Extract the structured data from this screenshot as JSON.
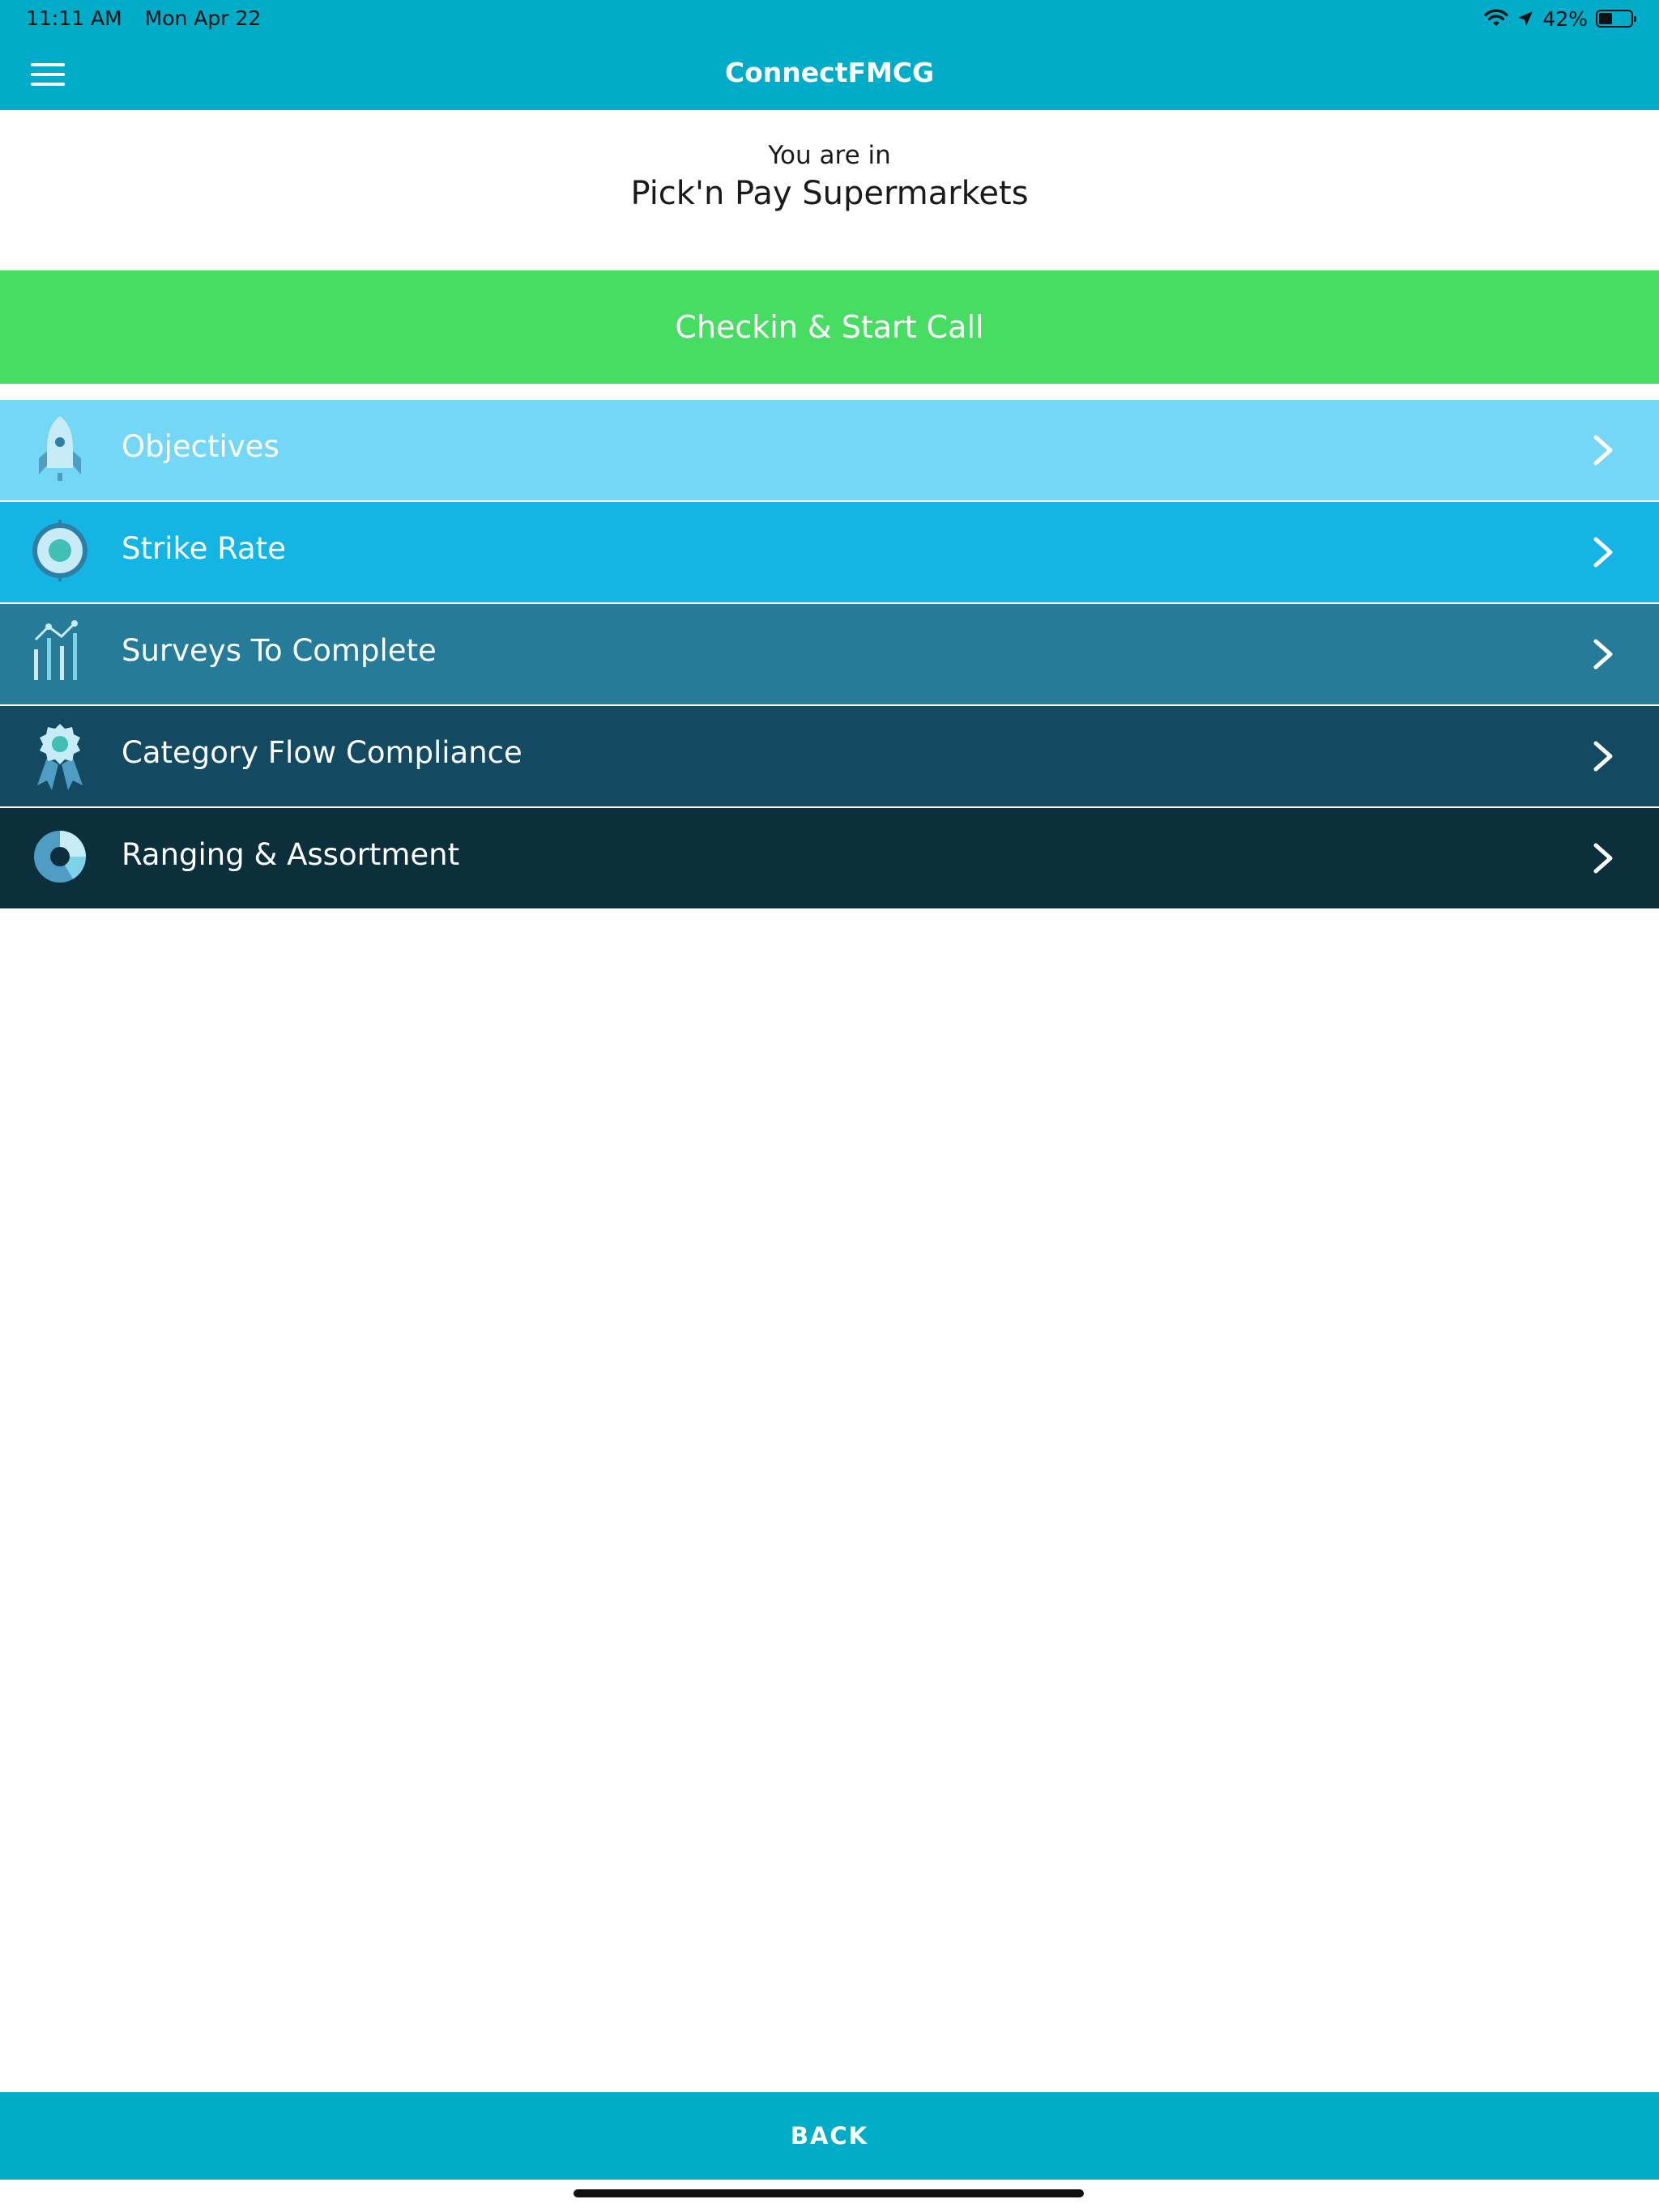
{
  "status_bar": {
    "time": "11:11 AM",
    "date": "Mon Apr 22",
    "battery_percent": "42%",
    "battery_level": 0.42,
    "icons": [
      "wifi-icon",
      "location-arrow-icon",
      "battery-icon"
    ]
  },
  "header": {
    "title": "ConnectFMCG",
    "menu_icon": "hamburger-menu-icon",
    "background_color": "#00acc8"
  },
  "location": {
    "label": "You are in",
    "name": "Pick'n Pay Supermarkets"
  },
  "checkin": {
    "label": "Checkin & Start Call",
    "color": "#47dd63"
  },
  "menu_items": [
    {
      "label": "Objectives",
      "icon": "rocket-icon",
      "color": "#74d7f6"
    },
    {
      "label": "Strike Rate",
      "icon": "target-icon",
      "color": "#14b4e4"
    },
    {
      "label": "Surveys To Complete",
      "icon": "bar-chart-icon",
      "color": "#267b98"
    },
    {
      "label": "Category Flow Compliance",
      "icon": "award-ribbon-icon",
      "color": "#134a61"
    },
    {
      "label": "Ranging & Assortment",
      "icon": "pie-chart-icon",
      "color": "#0c2f3c"
    }
  ],
  "footer": {
    "back_label": "BACK"
  }
}
